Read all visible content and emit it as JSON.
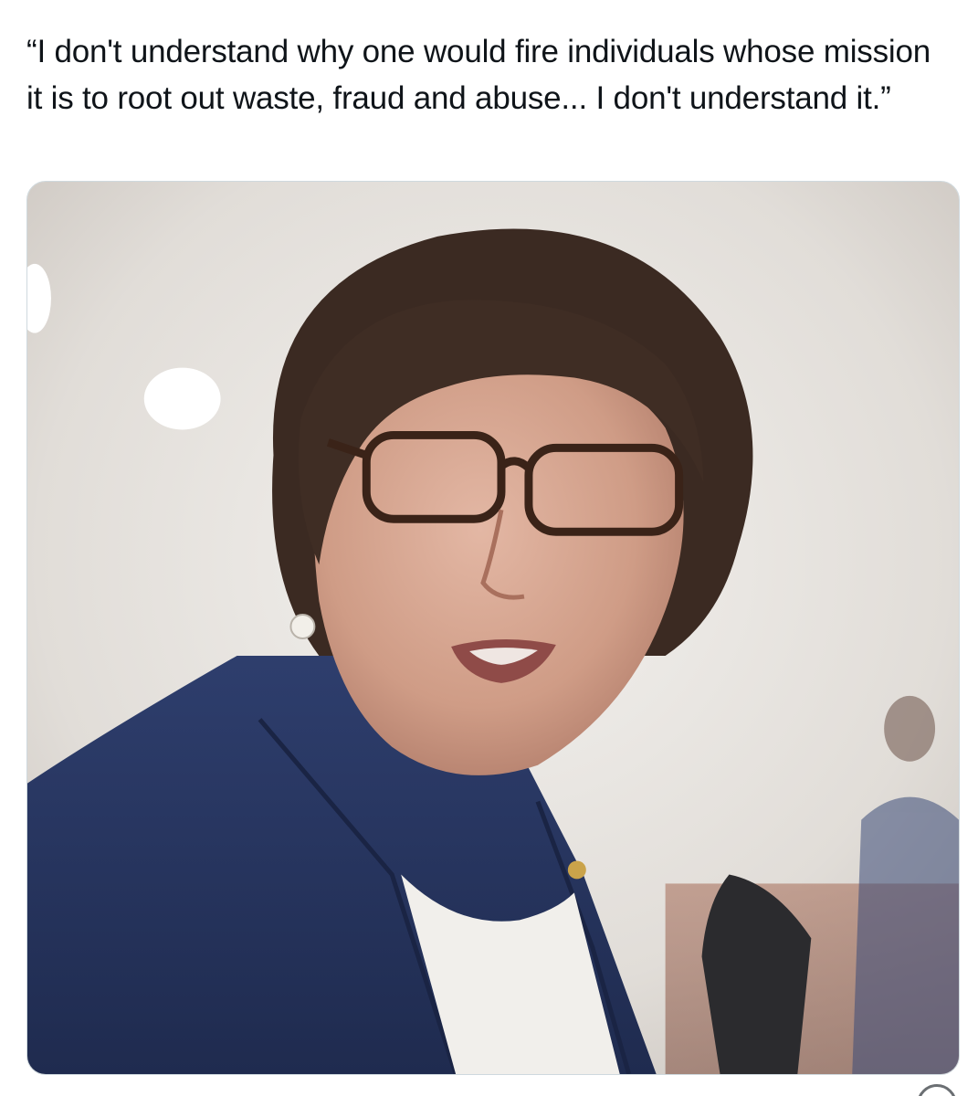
{
  "tweet": {
    "text": "“I don't understand why one would fire individuals whose mission it is to root out waste, fraud and abuse... I don't understand it.”"
  },
  "media": {
    "photo_icon": "portrait-photo",
    "colors": {
      "background": "#ebe8e4",
      "jacket": "#2b3b6b",
      "hair": "#3b2a22",
      "skin": "#d7a892",
      "strap": "#b07a52"
    }
  }
}
